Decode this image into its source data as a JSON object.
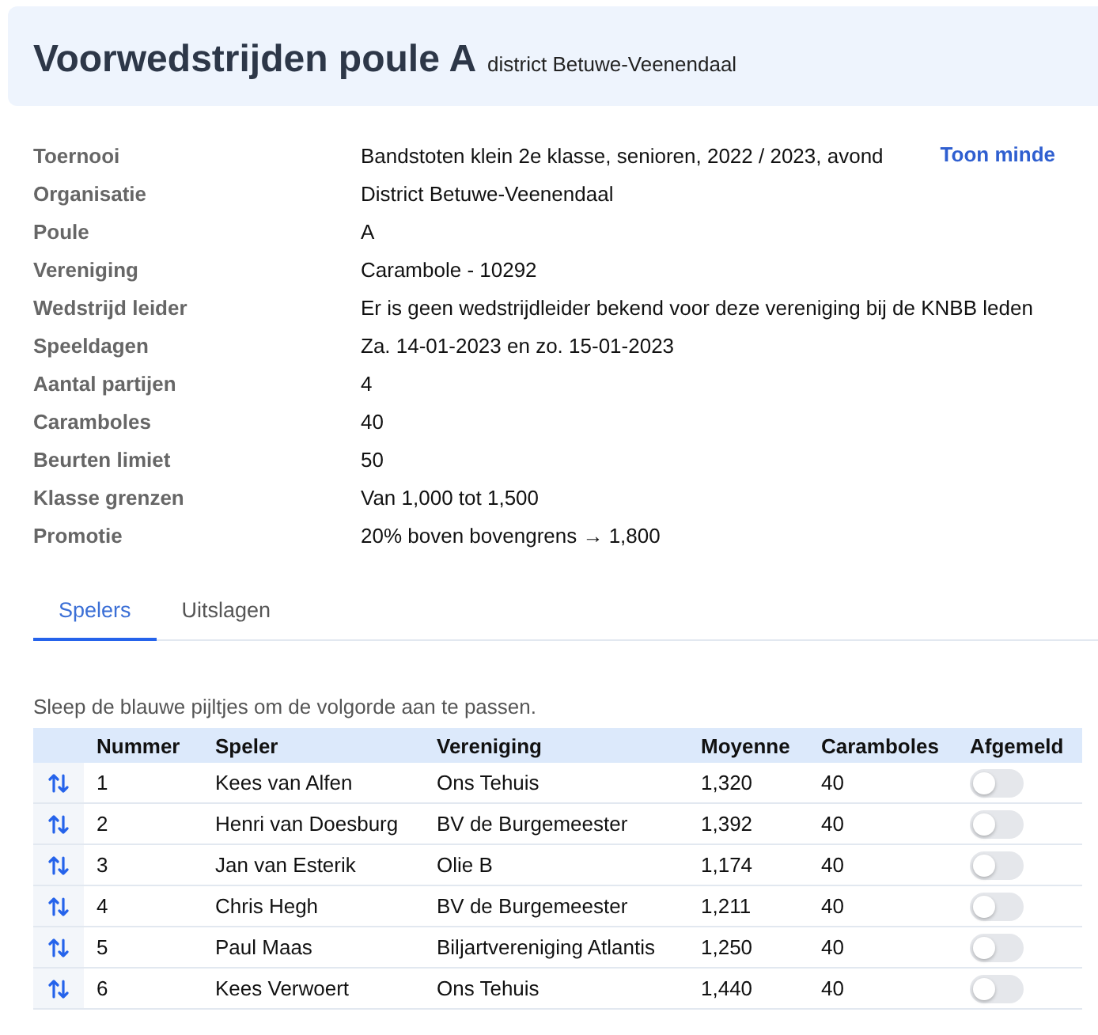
{
  "header": {
    "title": "Voorwedstrijden poule A",
    "subtitle": "district Betuwe-Veenendaal"
  },
  "details": [
    {
      "label": "Toernooi",
      "value": "Bandstoten klein 2e klasse, senioren, 2022 / 2023, avond"
    },
    {
      "label": "Organisatie",
      "value": "District Betuwe-Veenendaal"
    },
    {
      "label": "Poule",
      "value": "A"
    },
    {
      "label": "Vereniging",
      "value": "Carambole - 10292"
    },
    {
      "label": "Wedstrijd leider",
      "value": "Er is geen wedstrijdleider bekend voor deze vereniging bij de KNBB leden"
    },
    {
      "label": "Speeldagen",
      "value": "Za. 14-01-2023 en zo. 15-01-2023"
    },
    {
      "label": "Aantal partijen",
      "value": "4"
    },
    {
      "label": "Caramboles",
      "value": "40"
    },
    {
      "label": "Beurten limiet",
      "value": "50"
    },
    {
      "label": "Klasse grenzen",
      "value": "Van 1,000 tot 1,500"
    },
    {
      "label": "Promotie",
      "value": "20% boven bovengrens → 1,800"
    }
  ],
  "toggle_link": "Toon minde",
  "tabs": [
    {
      "label": "Spelers",
      "selected": true
    },
    {
      "label": "Uitslagen",
      "selected": false
    }
  ],
  "hint": "Sleep de blauwe pijltjes om de volgorde aan te passen.",
  "table": {
    "columns": [
      "Nummer",
      "Speler",
      "Vereniging",
      "Moyenne",
      "Caramboles",
      "Afgemeld"
    ],
    "rows": [
      {
        "nummer": "1",
        "speler": "Kees van Alfen",
        "vereniging": "Ons Tehuis",
        "moyenne": "1,320",
        "caramboles": "40",
        "afgemeld": false
      },
      {
        "nummer": "2",
        "speler": "Henri van Doesburg",
        "vereniging": "BV de Burgemeester",
        "moyenne": "1,392",
        "caramboles": "40",
        "afgemeld": false
      },
      {
        "nummer": "3",
        "speler": "Jan van Esterik",
        "vereniging": "Olie B",
        "moyenne": "1,174",
        "caramboles": "40",
        "afgemeld": false
      },
      {
        "nummer": "4",
        "speler": "Chris Hegh",
        "vereniging": "BV de Burgemeester",
        "moyenne": "1,211",
        "caramboles": "40",
        "afgemeld": false
      },
      {
        "nummer": "5",
        "speler": "Paul Maas",
        "vereniging": "Biljartvereniging Atlantis",
        "moyenne": "1,250",
        "caramboles": "40",
        "afgemeld": false
      },
      {
        "nummer": "6",
        "speler": "Kees Verwoert",
        "vereniging": "Ons Tehuis",
        "moyenne": "1,440",
        "caramboles": "40",
        "afgemeld": false
      }
    ]
  }
}
